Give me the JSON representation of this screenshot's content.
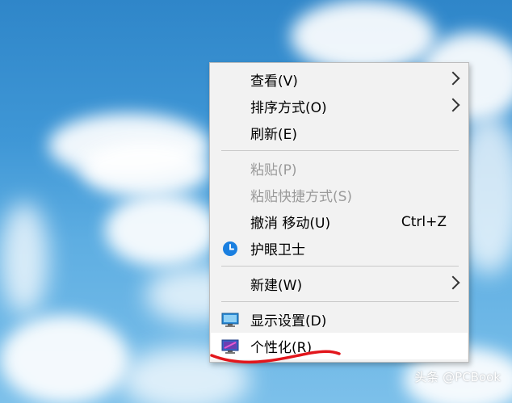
{
  "context_menu": {
    "items": [
      {
        "label": "查看(V)",
        "submenu": true
      },
      {
        "label": "排序方式(O)",
        "submenu": true
      },
      {
        "label": "刷新(E)"
      },
      {
        "label": "粘贴(P)",
        "disabled": true
      },
      {
        "label": "粘贴快捷方式(S)",
        "disabled": true
      },
      {
        "label": "撤消 移动(U)",
        "shortcut": "Ctrl+Z"
      },
      {
        "label": "护眼卫士",
        "icon": "blue-clock-icon"
      },
      {
        "label": "新建(W)",
        "submenu": true
      },
      {
        "label": "显示设置(D)",
        "icon": "display-icon"
      },
      {
        "label": "个性化(R)",
        "icon": "personalize-icon",
        "hovered": true
      }
    ]
  },
  "watermark": "头条 @PCBook",
  "colors": {
    "menu_bg": "#f2f2f2",
    "hover_bg": "#ffffff",
    "disabled_text": "#9a9a9a",
    "annotation_red": "#e2161c"
  }
}
